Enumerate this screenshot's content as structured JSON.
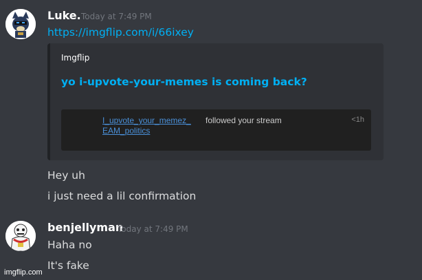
{
  "messages": [
    {
      "username": "Luke.",
      "timestamp": "Today at 7:49 PM",
      "link": "https://imgflip.com/i/66ixey",
      "embed": {
        "provider": "Imgflip",
        "title": "yo i-upvote-your-memes is coming back?",
        "image_text": {
          "link_user": "I_upvote_your_memez_",
          "rest": "followed your stream",
          "link_stream": "EAM_politics",
          "time": "<1h"
        }
      },
      "lines": [
        "Hey uh",
        "i just need a lil confirmation"
      ]
    },
    {
      "username": "benjellyman",
      "timestamp": "Today at 7:49 PM",
      "lines": [
        "Haha no",
        "It's fake"
      ]
    }
  ],
  "watermark": "imgflip.com"
}
